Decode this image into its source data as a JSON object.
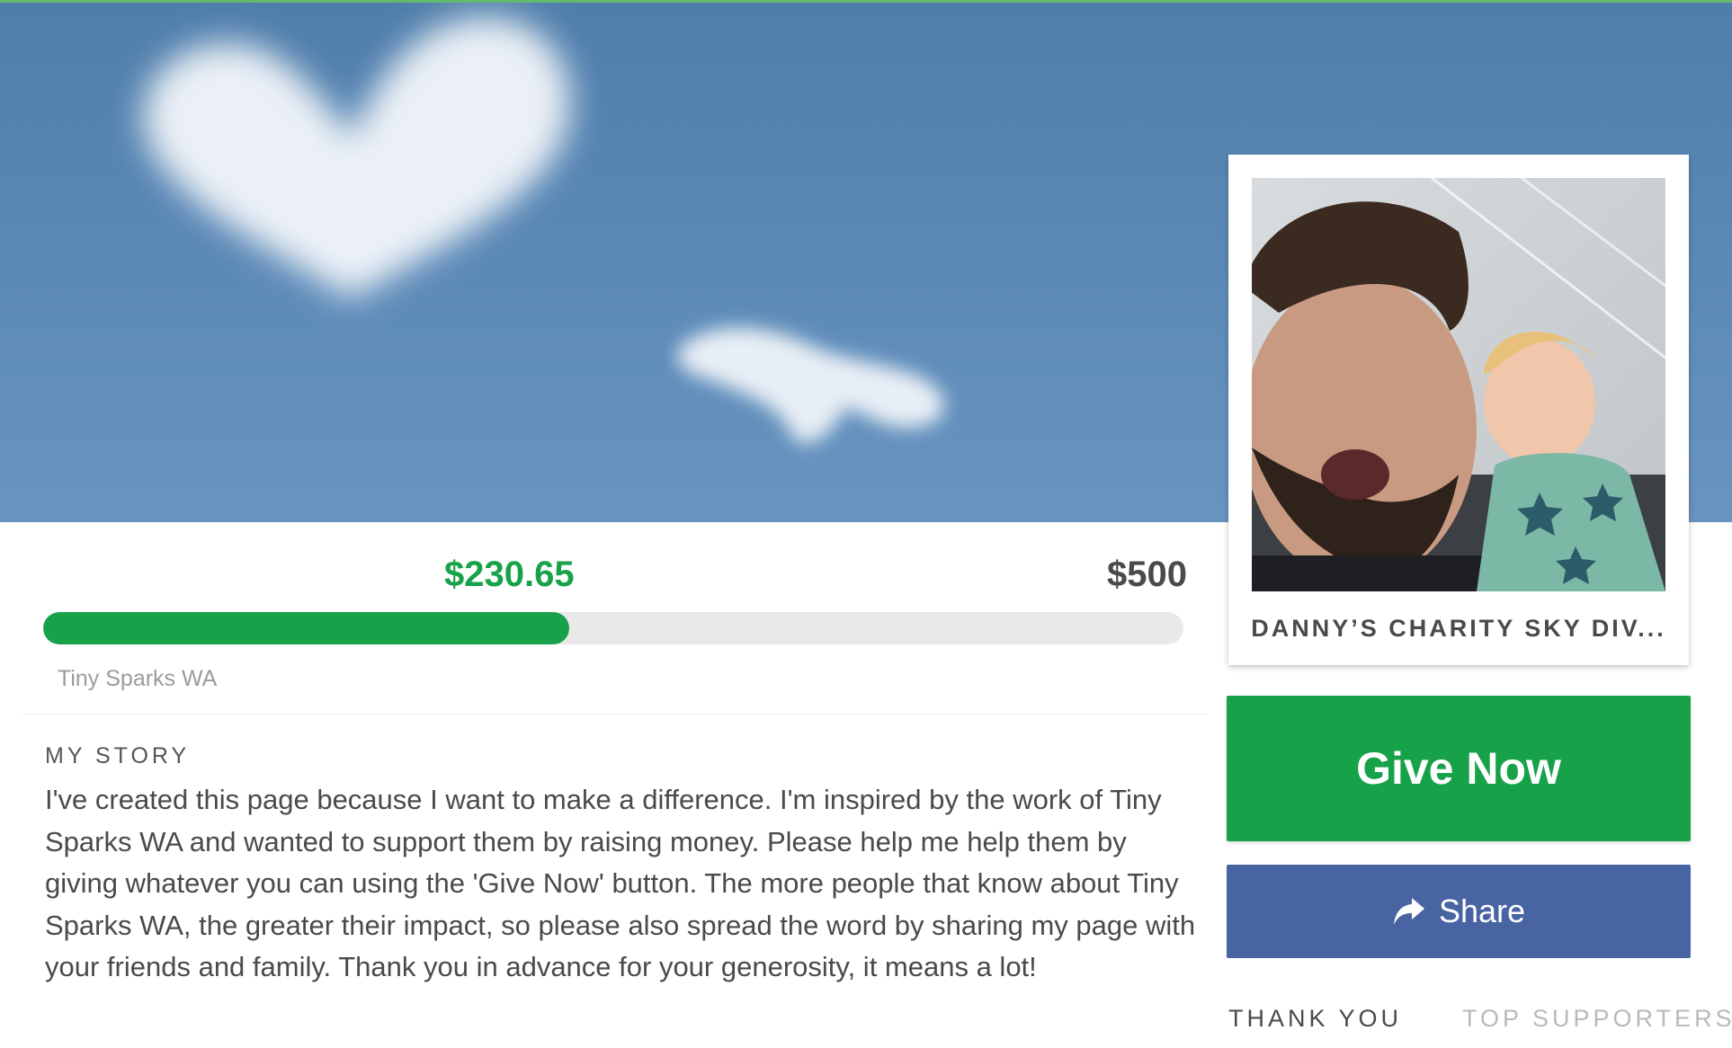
{
  "colors": {
    "accent_green": "#17a24a",
    "share_blue": "#4864a3",
    "sky_blue": "#5a88b6"
  },
  "fundraiser": {
    "raised": "$230.65",
    "target": "$500",
    "progress_fraction": 0.4613,
    "charity": "Tiny Sparks WA"
  },
  "story": {
    "heading": "MY STORY",
    "body": "I've created this page because I want to make a difference. I'm inspired by the work of Tiny Sparks WA and wanted to support them by raising money. Please help me help them by giving whatever you can using the 'Give Now' button. The more people that know about Tiny Sparks WA, the greater their impact, so please also spread the word by sharing my page with your friends and family. Thank you in advance for your generosity, it means a lot!"
  },
  "profile": {
    "title": "DANNY’S CHARITY SKY DIV...",
    "photo_icon": "profile-photo"
  },
  "actions": {
    "give_label": "Give Now",
    "share_label": "Share",
    "share_icon": "share-arrow-icon"
  },
  "tabs": [
    {
      "label": "THANK YOU",
      "active": true
    },
    {
      "label": "TOP SUPPORTERS",
      "active": false
    }
  ]
}
